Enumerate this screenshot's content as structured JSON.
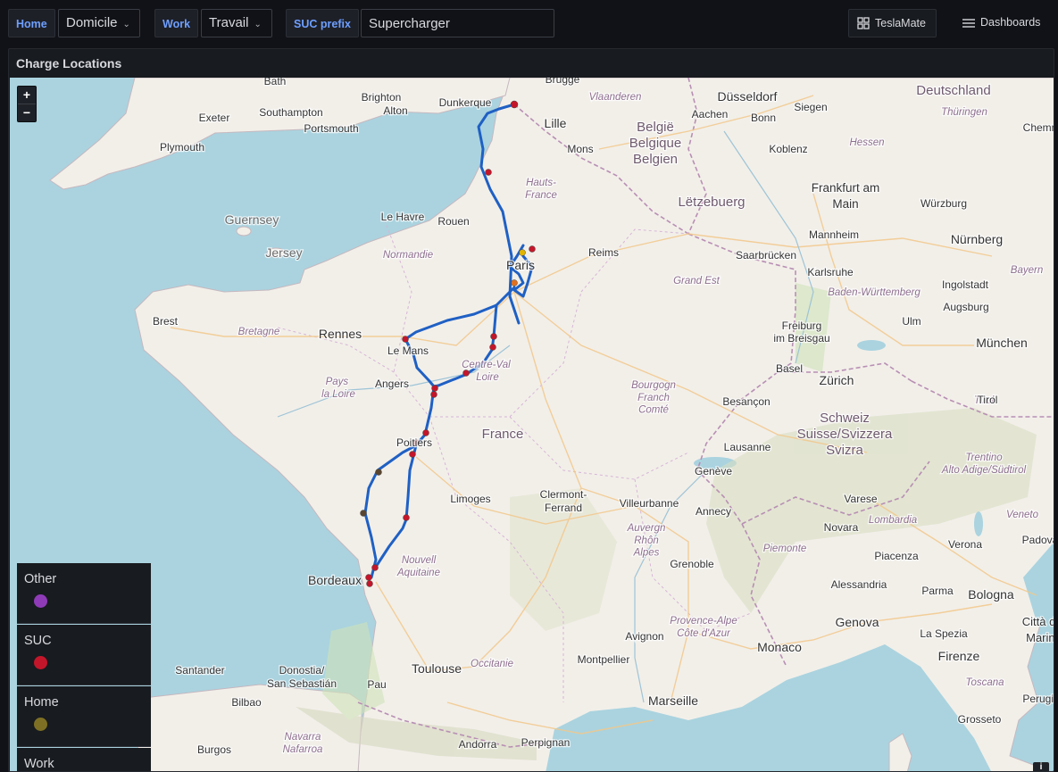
{
  "topbar": {
    "home": {
      "label": "Home",
      "value": "Domicile"
    },
    "work": {
      "label": "Work",
      "value": "Travail"
    },
    "suc_prefix": {
      "label": "SUC prefix",
      "value": "Supercharger"
    },
    "teslamate_label": "TeslaMate",
    "dashboards_label": "Dashboards"
  },
  "panel": {
    "title": "Charge Locations",
    "zoom_in": "+",
    "zoom_out": "−",
    "info": "i"
  },
  "legend": [
    {
      "label": "Other",
      "color": "#8f3bb8"
    },
    {
      "label": "SUC",
      "color": "#c4162a"
    },
    {
      "label": "Home",
      "color": "#7d7024"
    },
    {
      "label": "Work",
      "color": "#8a4f1e"
    }
  ],
  "map": {
    "country_labels": [
      "France",
      "België / Belgique / Belgien",
      "Deutschland",
      "Schweiz/ Suisse/Svizzera/ Svizra",
      "Lëtzebuerg"
    ],
    "region_labels": [
      "Normandie",
      "Bretagne",
      "Pays de la Loire",
      "Centre-Val de Loire",
      "Hauts-de-France",
      "Grand Est",
      "Bourgogne-Franche-Comté",
      "Nouvelle-Aquitaine",
      "Auvergne-Rhône-Alpes",
      "Occitanie",
      "Provence-Alpes-Côte d'Azur",
      "Vlaanderen",
      "Hessen",
      "Thüringen",
      "Bayern",
      "Baden-Württemberg",
      "Lombardia",
      "Piemonte",
      "Veneto",
      "Trentino-Alto Adige/Südtirol",
      "Toscana",
      "Tirol",
      "Navarra Nafarroa"
    ],
    "city_labels": [
      "Bath",
      "Brighton",
      "Alton",
      "Exeter",
      "Southampton",
      "Portsmouth",
      "Plymouth",
      "Guernsey",
      "Jersey",
      "Le Havre",
      "Rouen",
      "Dunkerque",
      "Lille",
      "Brugge",
      "Mons",
      "Düsseldorf",
      "Aachen",
      "Bonn",
      "Siegen",
      "Koblenz",
      "Frankfurt am Main",
      "Würzburg",
      "Mannheim",
      "Nürnberg",
      "Saarbrücken",
      "Karlsruhe",
      "Ingolstadt",
      "Augsburg",
      "Ulm",
      "München",
      "Freiburg im Breisgau",
      "Basel",
      "Zürich",
      "Besançon",
      "Lausanne",
      "Genève",
      "Annecy",
      "Varese",
      "Novara",
      "Verona",
      "Padova",
      "Piacenza",
      "Parma",
      "Bologna",
      "Alessandria",
      "Genova",
      "La Spezia",
      "Firenze",
      "Grosseto",
      "Città di Marino",
      "Reims",
      "Paris",
      "Brest",
      "Rennes",
      "Le Mans",
      "Angers",
      "Poitiers",
      "Limoges",
      "Clermont-Ferrand",
      "Villeurbanne",
      "Grenoble",
      "Avignon",
      "Monaco",
      "Marseille",
      "Montpellier",
      "Toulouse",
      "Bordeaux",
      "Santander",
      "Donostia/ San Sebastián",
      "Bilbao",
      "Pau",
      "Burgos",
      "Andorra",
      "Perpignan",
      "Perugia",
      "Chemnitz",
      "Tirol"
    ]
  }
}
